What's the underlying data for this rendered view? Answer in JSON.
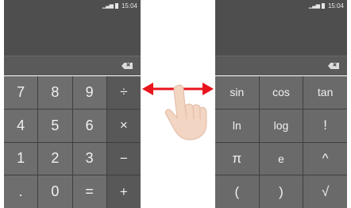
{
  "left_screen": {
    "status": {
      "time": "15:04",
      "signal_icon": "signal-icon",
      "battery_icon": "battery-icon"
    },
    "delete_icon": "backspace-icon",
    "delete_glyph": "✖",
    "keys": [
      "7",
      "8",
      "9",
      "÷",
      "4",
      "5",
      "6",
      "×",
      "1",
      "2",
      "3",
      "−",
      ".",
      "0",
      "=",
      "+"
    ]
  },
  "right_screen": {
    "status": {
      "time": "15:04",
      "signal_icon": "signal-icon",
      "battery_icon": "battery-icon"
    },
    "delete_icon": "backspace-icon",
    "delete_glyph": "✖",
    "keys": [
      "sin",
      "cos",
      "tan",
      "ln",
      "log",
      "!",
      "π",
      "e",
      "^",
      "(",
      ")",
      "√"
    ]
  },
  "gesture": {
    "icon": "swipe-hand-icon",
    "arrows": "left-right-arrows-icon",
    "arrow_color": "#e8141e"
  }
}
